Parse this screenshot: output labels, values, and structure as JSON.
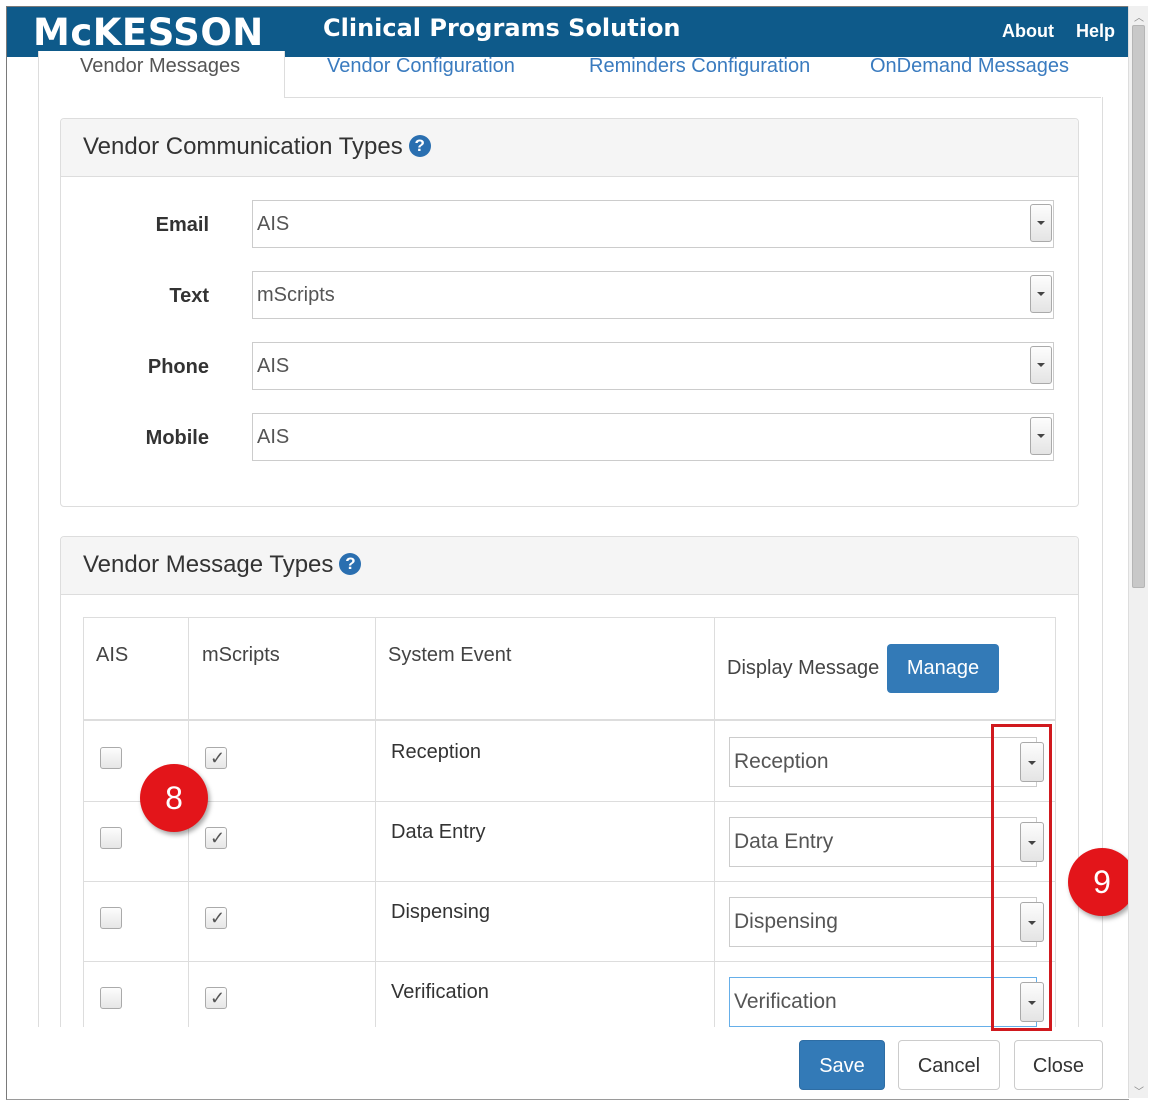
{
  "header": {
    "logo": "McKESSON",
    "app_title": "Clinical Programs Solution",
    "links": {
      "about": "About",
      "help": "Help"
    }
  },
  "tabs": [
    {
      "label": "Vendor Messages",
      "active": true
    },
    {
      "label": "Vendor Configuration",
      "active": false
    },
    {
      "label": "Reminders Configuration",
      "active": false
    },
    {
      "label": "OnDemand Messages",
      "active": false
    }
  ],
  "communication_types": {
    "title": "Vendor Communication Types",
    "help_icon": "question-circle-icon",
    "rows": [
      {
        "label": "Email",
        "value": "AIS"
      },
      {
        "label": "Text",
        "value": "mScripts"
      },
      {
        "label": "Phone",
        "value": "AIS"
      },
      {
        "label": "Mobile",
        "value": "AIS"
      }
    ]
  },
  "message_types": {
    "title": "Vendor Message Types",
    "help_icon": "question-circle-icon",
    "columns": {
      "ais": "AIS",
      "mscripts": "mScripts",
      "system_event": "System Event",
      "display_message": "Display Message"
    },
    "manage_label": "Manage",
    "rows": [
      {
        "ais": false,
        "mscripts": true,
        "event": "Reception",
        "message": "Reception"
      },
      {
        "ais": false,
        "mscripts": true,
        "event": "Data Entry",
        "message": "Data Entry"
      },
      {
        "ais": false,
        "mscripts": true,
        "event": "Dispensing",
        "message": "Dispensing"
      },
      {
        "ais": false,
        "mscripts": true,
        "event": "Verification",
        "message": "Verification"
      }
    ]
  },
  "footer": {
    "save": "Save",
    "cancel": "Cancel",
    "close": "Close"
  },
  "callouts": {
    "first": "8",
    "second": "9"
  },
  "colors": {
    "header_bg": "#0e5a8a",
    "primary": "#337ab7",
    "callout": "#e3151a",
    "link": "#3a7bbf"
  }
}
